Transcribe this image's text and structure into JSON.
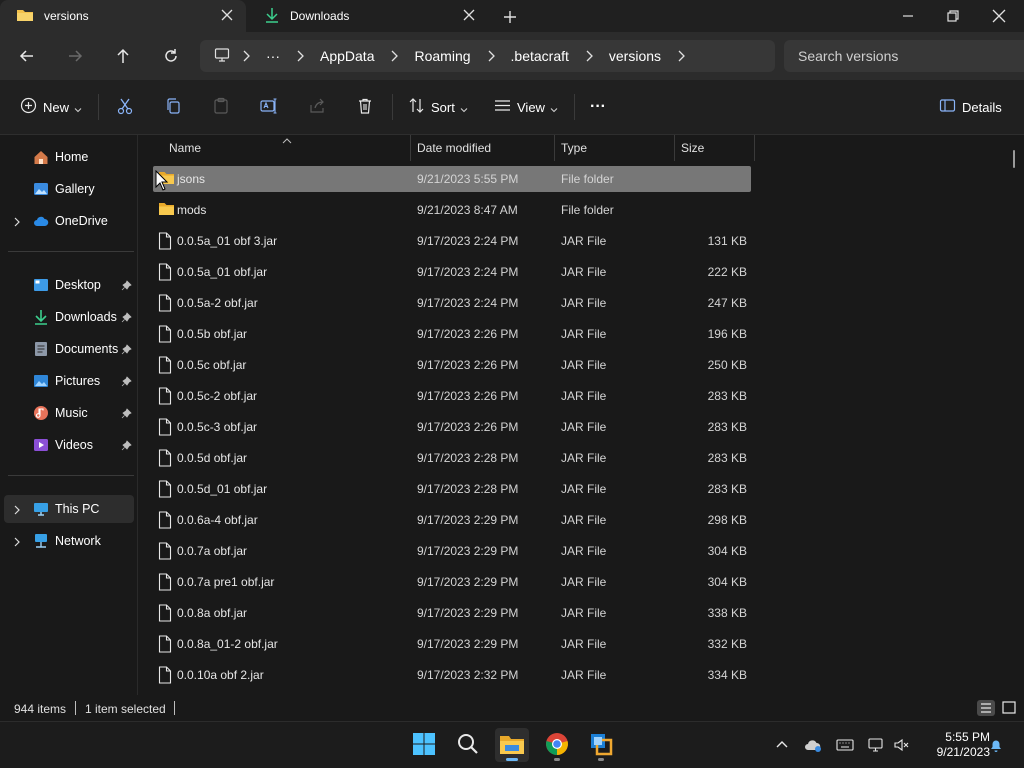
{
  "tabs": [
    {
      "label": "versions",
      "active": true,
      "icon": "folder-icon"
    },
    {
      "label": "Downloads",
      "active": false,
      "icon": "download-icon"
    }
  ],
  "window_controls": [
    "minimize",
    "restore",
    "close"
  ],
  "breadcrumb": {
    "items": [
      "AppData",
      "Roaming",
      ".betacraft",
      "versions"
    ],
    "overflow": "···"
  },
  "search": {
    "placeholder": "Search versions",
    "value": ""
  },
  "commandbar": {
    "new_label": "New",
    "sort_label": "Sort",
    "view_label": "View",
    "more_label": "···",
    "details_label": "Details"
  },
  "sidebar": {
    "items": [
      {
        "label": "Home",
        "icon": "home-icon"
      },
      {
        "label": "Gallery",
        "icon": "gallery-icon"
      },
      {
        "label": "OneDrive",
        "icon": "cloud-icon"
      },
      {
        "label": "Desktop",
        "icon": "desktop-icon"
      },
      {
        "label": "Downloads",
        "icon": "download-icon"
      },
      {
        "label": "Documents",
        "icon": "documents-icon"
      },
      {
        "label": "Pictures",
        "icon": "pictures-icon"
      },
      {
        "label": "Music",
        "icon": "music-icon"
      },
      {
        "label": "Videos",
        "icon": "videos-icon"
      },
      {
        "label": "This PC",
        "icon": "pc-icon"
      },
      {
        "label": "Network",
        "icon": "network-icon"
      }
    ]
  },
  "columns": [
    "Name",
    "Date modified",
    "Type",
    "Size"
  ],
  "files": [
    {
      "name": "jsons",
      "date": "9/21/2023 5:55 PM",
      "type": "File folder",
      "size": "",
      "kind": "folder",
      "selected": true
    },
    {
      "name": "mods",
      "date": "9/21/2023 8:47 AM",
      "type": "File folder",
      "size": "",
      "kind": "folder",
      "selected": false
    },
    {
      "name": "0.0.5a_01 obf 3.jar",
      "date": "9/17/2023 2:24 PM",
      "type": "JAR File",
      "size": "131 KB",
      "kind": "file",
      "selected": false
    },
    {
      "name": "0.0.5a_01 obf.jar",
      "date": "9/17/2023 2:24 PM",
      "type": "JAR File",
      "size": "222 KB",
      "kind": "file",
      "selected": false
    },
    {
      "name": "0.0.5a-2 obf.jar",
      "date": "9/17/2023 2:24 PM",
      "type": "JAR File",
      "size": "247 KB",
      "kind": "file",
      "selected": false
    },
    {
      "name": "0.0.5b obf.jar",
      "date": "9/17/2023 2:26 PM",
      "type": "JAR File",
      "size": "196 KB",
      "kind": "file",
      "selected": false
    },
    {
      "name": "0.0.5c obf.jar",
      "date": "9/17/2023 2:26 PM",
      "type": "JAR File",
      "size": "250 KB",
      "kind": "file",
      "selected": false
    },
    {
      "name": "0.0.5c-2 obf.jar",
      "date": "9/17/2023 2:26 PM",
      "type": "JAR File",
      "size": "283 KB",
      "kind": "file",
      "selected": false
    },
    {
      "name": "0.0.5c-3 obf.jar",
      "date": "9/17/2023 2:26 PM",
      "type": "JAR File",
      "size": "283 KB",
      "kind": "file",
      "selected": false
    },
    {
      "name": "0.0.5d obf.jar",
      "date": "9/17/2023 2:28 PM",
      "type": "JAR File",
      "size": "283 KB",
      "kind": "file",
      "selected": false
    },
    {
      "name": "0.0.5d_01 obf.jar",
      "date": "9/17/2023 2:28 PM",
      "type": "JAR File",
      "size": "283 KB",
      "kind": "file",
      "selected": false
    },
    {
      "name": "0.0.6a-4 obf.jar",
      "date": "9/17/2023 2:29 PM",
      "type": "JAR File",
      "size": "298 KB",
      "kind": "file",
      "selected": false
    },
    {
      "name": "0.0.7a obf.jar",
      "date": "9/17/2023 2:29 PM",
      "type": "JAR File",
      "size": "304 KB",
      "kind": "file",
      "selected": false
    },
    {
      "name": "0.0.7a pre1 obf.jar",
      "date": "9/17/2023 2:29 PM",
      "type": "JAR File",
      "size": "304 KB",
      "kind": "file",
      "selected": false
    },
    {
      "name": "0.0.8a obf.jar",
      "date": "9/17/2023 2:29 PM",
      "type": "JAR File",
      "size": "338 KB",
      "kind": "file",
      "selected": false
    },
    {
      "name": "0.0.8a_01-2 obf.jar",
      "date": "9/17/2023 2:29 PM",
      "type": "JAR File",
      "size": "332 KB",
      "kind": "file",
      "selected": false
    },
    {
      "name": "0.0.10a obf 2.jar",
      "date": "9/17/2023 2:32 PM",
      "type": "JAR File",
      "size": "334 KB",
      "kind": "file",
      "selected": false
    }
  ],
  "status": {
    "items_count": "944 items",
    "selection": "1 item selected"
  },
  "taskbar": {
    "apps": [
      {
        "name": "start-icon"
      },
      {
        "name": "search-icon"
      },
      {
        "name": "file-explorer-icon",
        "active": true
      },
      {
        "name": "chrome-icon"
      },
      {
        "name": "app-icon"
      }
    ],
    "clock_time": "5:55 PM",
    "clock_date": "9/21/2023"
  },
  "colors": {
    "accent": "#6cb8f6",
    "folder": "#f3c14b",
    "selected_row": "#777777"
  }
}
